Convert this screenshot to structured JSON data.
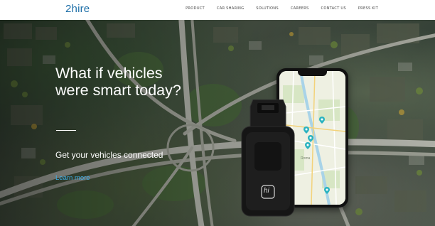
{
  "header": {
    "logo": "2hire",
    "nav": [
      {
        "label": "PRODUCT"
      },
      {
        "label": "CAR SHARING"
      },
      {
        "label": "SOLUTIONS"
      },
      {
        "label": "CAREERS"
      },
      {
        "label": "CONTACT US"
      },
      {
        "label": "PRESS KIT"
      }
    ]
  },
  "hero": {
    "headline_lines": [
      "What if vehicles",
      "were smart today?"
    ],
    "subheadline": "Get your vehicles connected",
    "cta_label": "Learn more"
  },
  "phone": {
    "map_city_label": "Roma"
  },
  "device": {
    "logo_text": "hi"
  },
  "colors": {
    "brand_blue": "#1e6fa8",
    "link_blue": "#3fb0e8",
    "nav_text": "#4a4a4a",
    "map_marker": "#2bb3c0"
  },
  "icons": [
    "map-marker-icon",
    "obd-device-logo"
  ]
}
